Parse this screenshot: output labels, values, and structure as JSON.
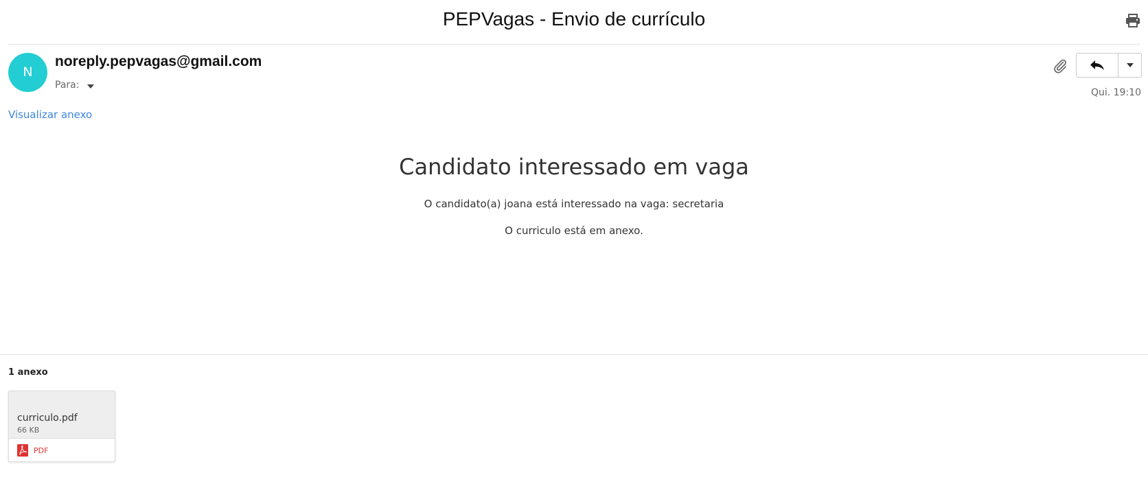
{
  "email": {
    "subject": "PEPVagas - Envio de currículo",
    "sender": "noreply.pepvagas@gmail.com",
    "avatar_initial": "N",
    "avatar_color": "#22cdd3",
    "recipients_label": "Para:",
    "date": "Qui. 19:10",
    "view_attachment_link": "Visualizar anexo"
  },
  "body": {
    "heading": "Candidato interessado em vaga",
    "line1": "O candidato(a) joana está interessado na vaga: secretaria",
    "line2": "O curriculo está em anexo."
  },
  "attachments": {
    "count_label": "1 anexo",
    "items": [
      {
        "name": "curriculo.pdf",
        "size": "66 KB",
        "type": "PDF",
        "icon": "pdf-icon"
      }
    ]
  },
  "icons": {
    "print": "printer-icon",
    "attachment": "paperclip-icon",
    "reply": "reply-arrow-icon",
    "more": "chevron-down-icon"
  },
  "colors": {
    "accent_link": "#3d86e0",
    "pdf_red": "#e03131"
  }
}
